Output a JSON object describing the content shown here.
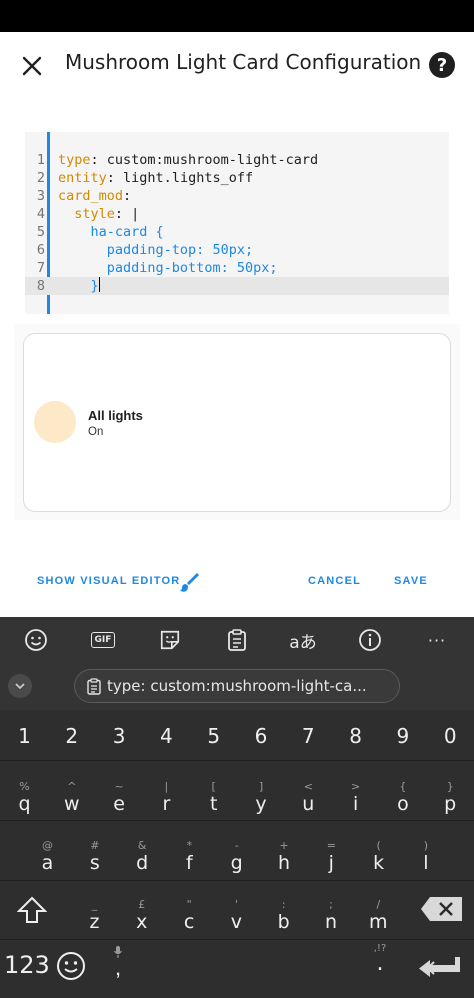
{
  "dialog": {
    "title": "Mushroom Light Card Configuration",
    "close_icon": "close-icon",
    "help_icon": "help-icon"
  },
  "editor": {
    "lines": [
      {
        "num": "1",
        "key": "type",
        "sep": ": ",
        "val": "custom:mushroom-light-card",
        "indent": ""
      },
      {
        "num": "2",
        "key": "entity",
        "sep": ": ",
        "val": "light.lights_off",
        "indent": ""
      },
      {
        "num": "3",
        "key": "card_mod",
        "sep": ":",
        "val": "",
        "indent": ""
      },
      {
        "num": "4",
        "key": "style",
        "sep": ": ",
        "val": "|",
        "indent": "  "
      },
      {
        "num": "5",
        "key": "",
        "sep": "",
        "val": "ha-card {",
        "indent": "    "
      },
      {
        "num": "6",
        "key": "",
        "sep": "",
        "val": "padding-top: 50px;",
        "indent": "      "
      },
      {
        "num": "7",
        "key": "",
        "sep": "",
        "val": "padding-bottom: 50px;",
        "indent": "      "
      },
      {
        "num": "8",
        "key": "",
        "sep": "",
        "val": "}",
        "indent": "    "
      }
    ]
  },
  "preview": {
    "name": "All lights",
    "state": "On",
    "icon_color": "#fde8c8"
  },
  "actions": {
    "show_visual_editor": "SHOW VISUAL EDITOR",
    "cancel": "CANCEL",
    "save": "SAVE",
    "accent": "#1e88e5"
  },
  "keyboard": {
    "toolbar_icons": [
      "emoji-icon",
      "gif-icon",
      "sticker-icon",
      "clipboard-icon",
      "translate-icon",
      "info-icon",
      "more-icon"
    ],
    "gif_label": "GIF",
    "translate_label": "aあ",
    "more_label": "···",
    "clipboard_text": "type: custom:mushroom-light-ca...",
    "number_row": [
      "1",
      "2",
      "3",
      "4",
      "5",
      "6",
      "7",
      "8",
      "9",
      "0"
    ],
    "row1": [
      {
        "main": "q",
        "sub": "%"
      },
      {
        "main": "w",
        "sub": "^"
      },
      {
        "main": "e",
        "sub": "~"
      },
      {
        "main": "r",
        "sub": "|"
      },
      {
        "main": "t",
        "sub": "["
      },
      {
        "main": "y",
        "sub": "]"
      },
      {
        "main": "u",
        "sub": "<"
      },
      {
        "main": "i",
        "sub": ">"
      },
      {
        "main": "o",
        "sub": "{"
      },
      {
        "main": "p",
        "sub": "}"
      }
    ],
    "row2": [
      {
        "main": "a",
        "sub": "@"
      },
      {
        "main": "s",
        "sub": "#"
      },
      {
        "main": "d",
        "sub": "&"
      },
      {
        "main": "f",
        "sub": "*"
      },
      {
        "main": "g",
        "sub": "-"
      },
      {
        "main": "h",
        "sub": "+"
      },
      {
        "main": "j",
        "sub": "="
      },
      {
        "main": "k",
        "sub": "("
      },
      {
        "main": "l",
        "sub": ")"
      }
    ],
    "row3": [
      {
        "main": "z",
        "sub": "_"
      },
      {
        "main": "x",
        "sub": "£"
      },
      {
        "main": "c",
        "sub": "\""
      },
      {
        "main": "v",
        "sub": "'"
      },
      {
        "main": "b",
        "sub": ":"
      },
      {
        "main": "n",
        "sub": ";"
      },
      {
        "main": "m",
        "sub": "/"
      }
    ],
    "symbols_key": "123",
    "comma": ",",
    "period": ".",
    "period_sub": ",!?",
    "shift_icon": "shift-icon",
    "backspace_icon": "backspace-icon",
    "enter_icon": "enter-icon",
    "emoji_key_icon": "emoji-icon",
    "mic_icon": "mic-icon"
  }
}
